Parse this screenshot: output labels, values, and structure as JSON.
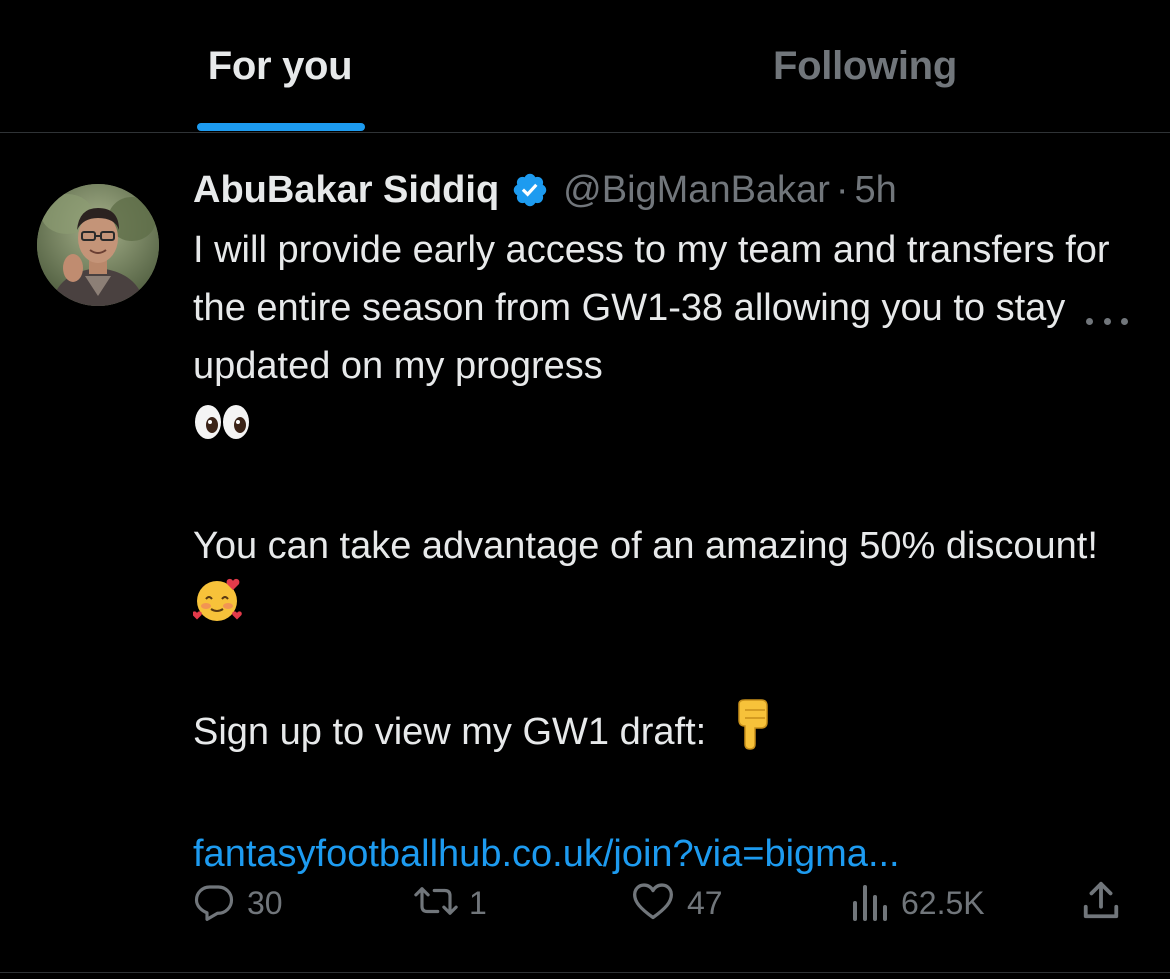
{
  "tabs": [
    {
      "label": "For you",
      "active": true
    },
    {
      "label": "Following",
      "active": false
    }
  ],
  "tweet": {
    "author_name": "AbuBakar Siddiq",
    "handle": "@BigManBakar",
    "separator": "·",
    "time": "5h",
    "body": {
      "para1": "I will provide early access to my team and transfers for the entire season from GW1-38 allowing you to stay updated on my progress",
      "para2": "You can take advantage of an amazing 50% discount!",
      "para3": "Sign up to view my GW1 draft:",
      "link": "fantasyfootballhub.co.uk/join?via=bigma..."
    },
    "stats": {
      "replies": "30",
      "retweets": "1",
      "likes": "47",
      "views": "62.5K"
    }
  },
  "icons": {
    "verified": "verified-badge-icon",
    "more": "more-dots-icon",
    "reply": "reply-icon",
    "retweet": "retweet-icon",
    "like": "heart-icon",
    "views": "views-icon",
    "share": "share-icon"
  },
  "colors": {
    "background": "#000000",
    "text": "#e7e9ea",
    "muted": "#71767b",
    "accent": "#1d9bf0",
    "divider": "#2f3336"
  }
}
